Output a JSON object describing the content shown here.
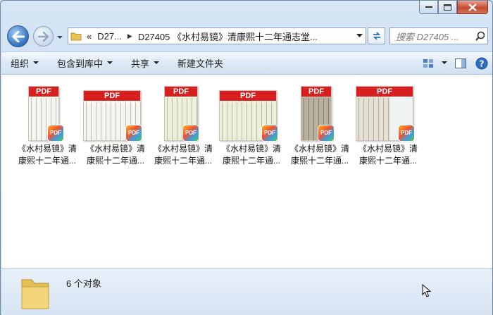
{
  "window": {
    "caption_buttons": [
      "minimize",
      "maximize",
      "close"
    ]
  },
  "address": {
    "overflow": "«",
    "crumbs": [
      "D27...",
      "D27405 《水村易镜》清康熙十二年通志堂..."
    ]
  },
  "search": {
    "placeholder": "搜索 D27405 ..."
  },
  "toolbar": {
    "organize": "组织",
    "include_library": "包含到库中",
    "share": "共享",
    "new_folder": "新建文件夹"
  },
  "files": [
    {
      "line1": "《水村易镜》清",
      "line2": "康熙十二年通...",
      "pdf_label": "PDF"
    },
    {
      "line1": "《水村易镜》清",
      "line2": "康熙十二年通...",
      "pdf_label": "PDF"
    },
    {
      "line1": "《水村易镜》清",
      "line2": "康熙十二年通...",
      "pdf_label": "PDF"
    },
    {
      "line1": "《水村易镜》清",
      "line2": "康熙十二年通...",
      "pdf_label": "PDF"
    },
    {
      "line1": "《水村易镜》清",
      "line2": "康熙十二年通...",
      "pdf_label": "PDF"
    },
    {
      "line1": "《水村易镜》清",
      "line2": "康熙十二年通...",
      "pdf_label": "PDF"
    }
  ],
  "status": {
    "count_text": "6 个对象"
  },
  "colors": {
    "pdf_red": "#d71f1f",
    "toolbar_bg": "#dce8f5",
    "window_frame": "#bcd2ea"
  }
}
